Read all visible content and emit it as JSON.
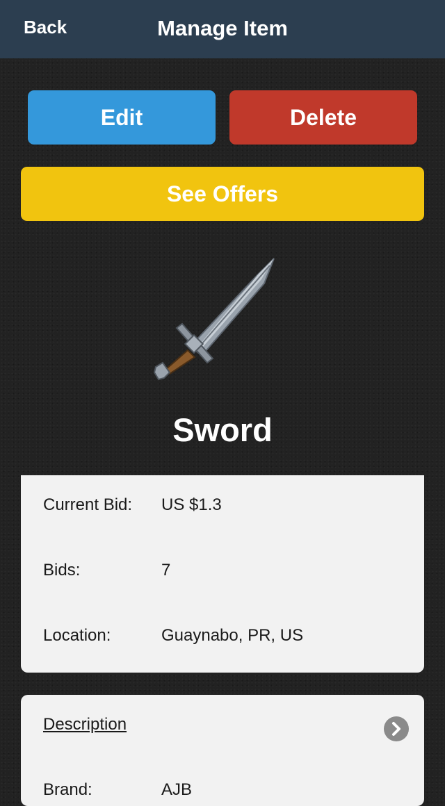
{
  "navbar": {
    "back_label": "Back",
    "title": "Manage Item"
  },
  "actions": {
    "edit_label": "Edit",
    "delete_label": "Delete",
    "offers_label": "See Offers"
  },
  "item": {
    "name": "Sword",
    "image_icon": "sword-icon"
  },
  "details": {
    "current_bid_label": "Current Bid:",
    "current_bid_value": "US $1.3",
    "bids_label": "Bids:",
    "bids_value": "7",
    "location_label": "Location:",
    "location_value": "Guaynabo, PR, US"
  },
  "description": {
    "link_label": "Description",
    "chevron_icon": "chevron-right-icon",
    "brand_label": "Brand:",
    "brand_value": "AJB"
  },
  "colors": {
    "navbar": "#2c3e50",
    "edit": "#3498db",
    "delete": "#c0392b",
    "offers": "#f1c40f",
    "background": "#222222",
    "card": "#f2f2f2"
  }
}
